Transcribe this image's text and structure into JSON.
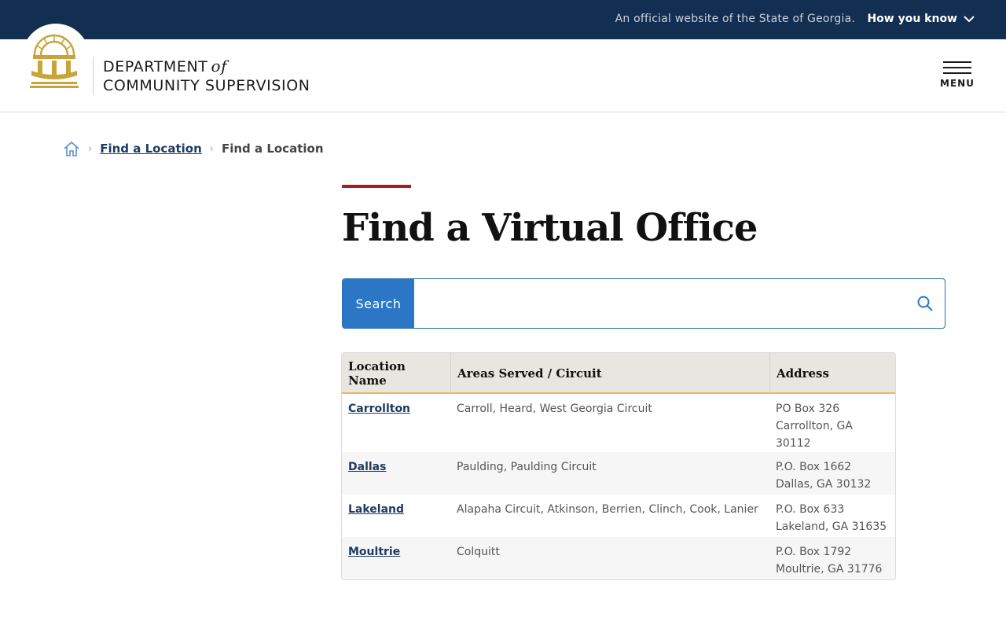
{
  "banner": {
    "official_text": "An official website of the State of Georgia.",
    "how_you_know": "How you know"
  },
  "header": {
    "dept_line1": "DEPARTMENT",
    "dept_of": "of",
    "dept_line2": "COMMUNITY SUPERVISION",
    "menu_label": "MENU"
  },
  "breadcrumb": {
    "items": [
      "Find a Location",
      "Find a Location"
    ]
  },
  "main": {
    "title": "Find a Virtual Office",
    "search_button": "Search",
    "search_value": ""
  },
  "table": {
    "headers": [
      "Location Name",
      "Areas Served / Circuit",
      "Address"
    ],
    "rows": [
      {
        "name": "Carrollton",
        "areas": "Carroll, Heard, West Georgia Circuit",
        "addr1": "PO Box 326",
        "addr2": "Carrollton, GA 30112"
      },
      {
        "name": "Dallas",
        "areas": "Paulding, Paulding Circuit",
        "addr1": "P.O. Box 1662",
        "addr2": "Dallas, GA 30132"
      },
      {
        "name": "Lakeland",
        "areas": "Alapaha Circuit, Atkinson, Berrien, Clinch, Cook, Lanier",
        "addr1": "P.O. Box 633",
        "addr2": "Lakeland, GA 31635"
      },
      {
        "name": "Moultrie",
        "areas": "Colquitt",
        "addr1": "P.O. Box 1792",
        "addr2": "Moultrie, GA 31776"
      }
    ]
  },
  "colors": {
    "banner_bg": "#122e51",
    "accent_red": "#a41e22",
    "search_blue": "#2b77c6",
    "table_header_rule": "#f2b84b",
    "seal_gold": "#c9a43a"
  },
  "icons": {
    "seal": "georgia-seal-icon",
    "chevron": "chevron-down-icon",
    "home": "home-icon",
    "search": "search-icon",
    "menu": "hamburger-icon"
  }
}
